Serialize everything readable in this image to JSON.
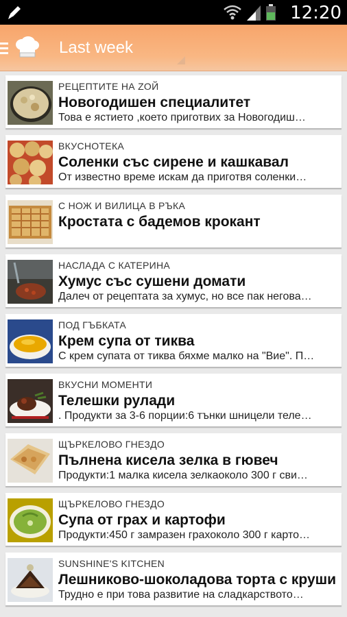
{
  "status_bar": {
    "time": "12:20"
  },
  "action_bar": {
    "title": "Last week"
  },
  "colors": {
    "action_bar": "#f9b783",
    "status_bar": "#000000",
    "background": "#e9e9e9"
  },
  "items": [
    {
      "source": "РЕЦЕПТИТЕ НА ZOЙ",
      "title": "Новогодишен специалитет",
      "excerpt": "Това е ястието ,което приготвих за Новогодиш…",
      "thumb": "casserole"
    },
    {
      "source": "ВКУСНОТЕКА",
      "title": "Соленки със сирене и кашкавал",
      "excerpt": "От известно време искам да приготвя соленки…",
      "thumb": "pastries"
    },
    {
      "source": "С НОЖ И ВИЛИЦА В РЪКА",
      "title": "Кростата с бадемов крокант",
      "excerpt": "",
      "thumb": "tart"
    },
    {
      "source": "НАСЛАДА С КАТЕРИНА",
      "title": "Хумус  със сушени домати",
      "excerpt": "Далеч от рецептата за хумус, но все пак негова…",
      "thumb": "hummus"
    },
    {
      "source": "ПОД ГЪБКАТА",
      "title": "Крем супа от тиква",
      "excerpt": "С крем супата от тиква бяхме малко на \"Вие\". П…",
      "thumb": "soup"
    },
    {
      "source": "ВКУСНИ МОМЕНТИ",
      "title": "Телешки рулади",
      "excerpt": ".  Продукти за 3-6 порции:6 тънки шницели теле…",
      "thumb": "rolls"
    },
    {
      "source": "ЩЪРКЕЛОВО ГНЕЗДО",
      "title": "Пълнена кисела зелка в гювеч",
      "excerpt": "Продукти:1 малка кисела зелкаоколо 300 г сви…",
      "thumb": "pie"
    },
    {
      "source": "ЩЪРКЕЛОВО ГНЕЗДО",
      "title": "Супа от грах и картофи",
      "excerpt": "Продукти:450 г замразен грахоколо 300 г карто…",
      "thumb": "pea"
    },
    {
      "source": "SUNSHINE'S KITCHEN",
      "title": "Лешниково-шоколадова торта с круши",
      "excerpt": "Трудно е при това развитие на сладкарството…",
      "thumb": "cake"
    }
  ]
}
